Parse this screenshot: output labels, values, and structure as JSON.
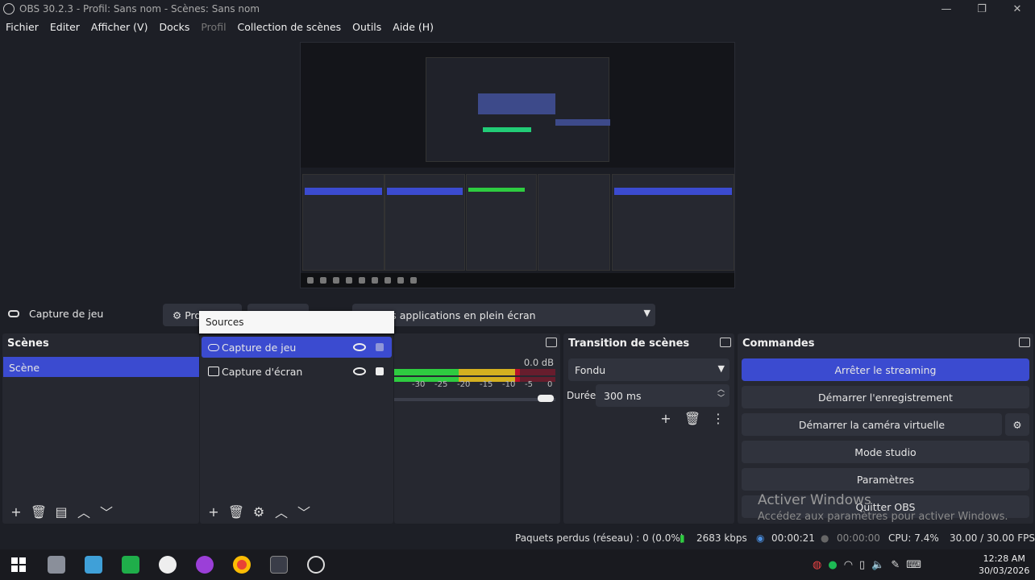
{
  "window": {
    "title": "OBS 30.2.3 - Profil: Sans nom - Scènes: Sans nom",
    "min": "—",
    "max": "❐",
    "close": "✕"
  },
  "menu": [
    "Fichier",
    "Editer",
    "Afficher (V)",
    "Docks",
    "Profil",
    "Collection de scènes",
    "Outils",
    "Aide (H)"
  ],
  "context": {
    "source_name": "Capture de jeu",
    "properties_label": "Pro",
    "filters_label": "",
    "mode_value": "r les applications en plein écran"
  },
  "sources_popup": {
    "title": "Sources"
  },
  "scenes": {
    "title": "Scènes",
    "items": [
      "Scène"
    ]
  },
  "sources": {
    "items": [
      {
        "label": "Capture de jeu",
        "selected": true
      },
      {
        "label": "Capture d'écran",
        "selected": false
      }
    ]
  },
  "mixer": {
    "db_value": "0.0 dB",
    "ticks": [
      "-30",
      "-25",
      "-20",
      "-15",
      "-10",
      "-5",
      "0"
    ],
    "level": 0.78
  },
  "transitions": {
    "title": "Transition de scènes",
    "selected": "Fondu",
    "duration_label": "Durée",
    "duration_value": "300 ms"
  },
  "controls": {
    "title": "Commandes",
    "buttons": [
      "Arrêter le streaming",
      "Démarrer l'enregistrement",
      "Démarrer la caméra virtuelle",
      "Mode studio",
      "Paramètres",
      "Quitter OBS"
    ]
  },
  "watermark": {
    "line1": "Activer Windows",
    "line2": "Accédez aux paramètres pour activer Windows."
  },
  "status": {
    "dropped": "Paquets perdus (réseau) : 0 (0.0%)",
    "bitrate": "2683 kbps",
    "stream_time": "00:00:21",
    "rec_time": "00:00:00",
    "cpu": "CPU: 7.4%",
    "fps": "30.00 / 30.00 FPS"
  },
  "tray": {
    "time": "12:28 AM",
    "date": "30/03/2026"
  },
  "colors": {
    "accent": "#3b4bd0",
    "panel": "#262830",
    "bg": "#1d1f26",
    "green": "#2ecc40",
    "yellow": "#d4b020",
    "red": "#b8102a"
  }
}
